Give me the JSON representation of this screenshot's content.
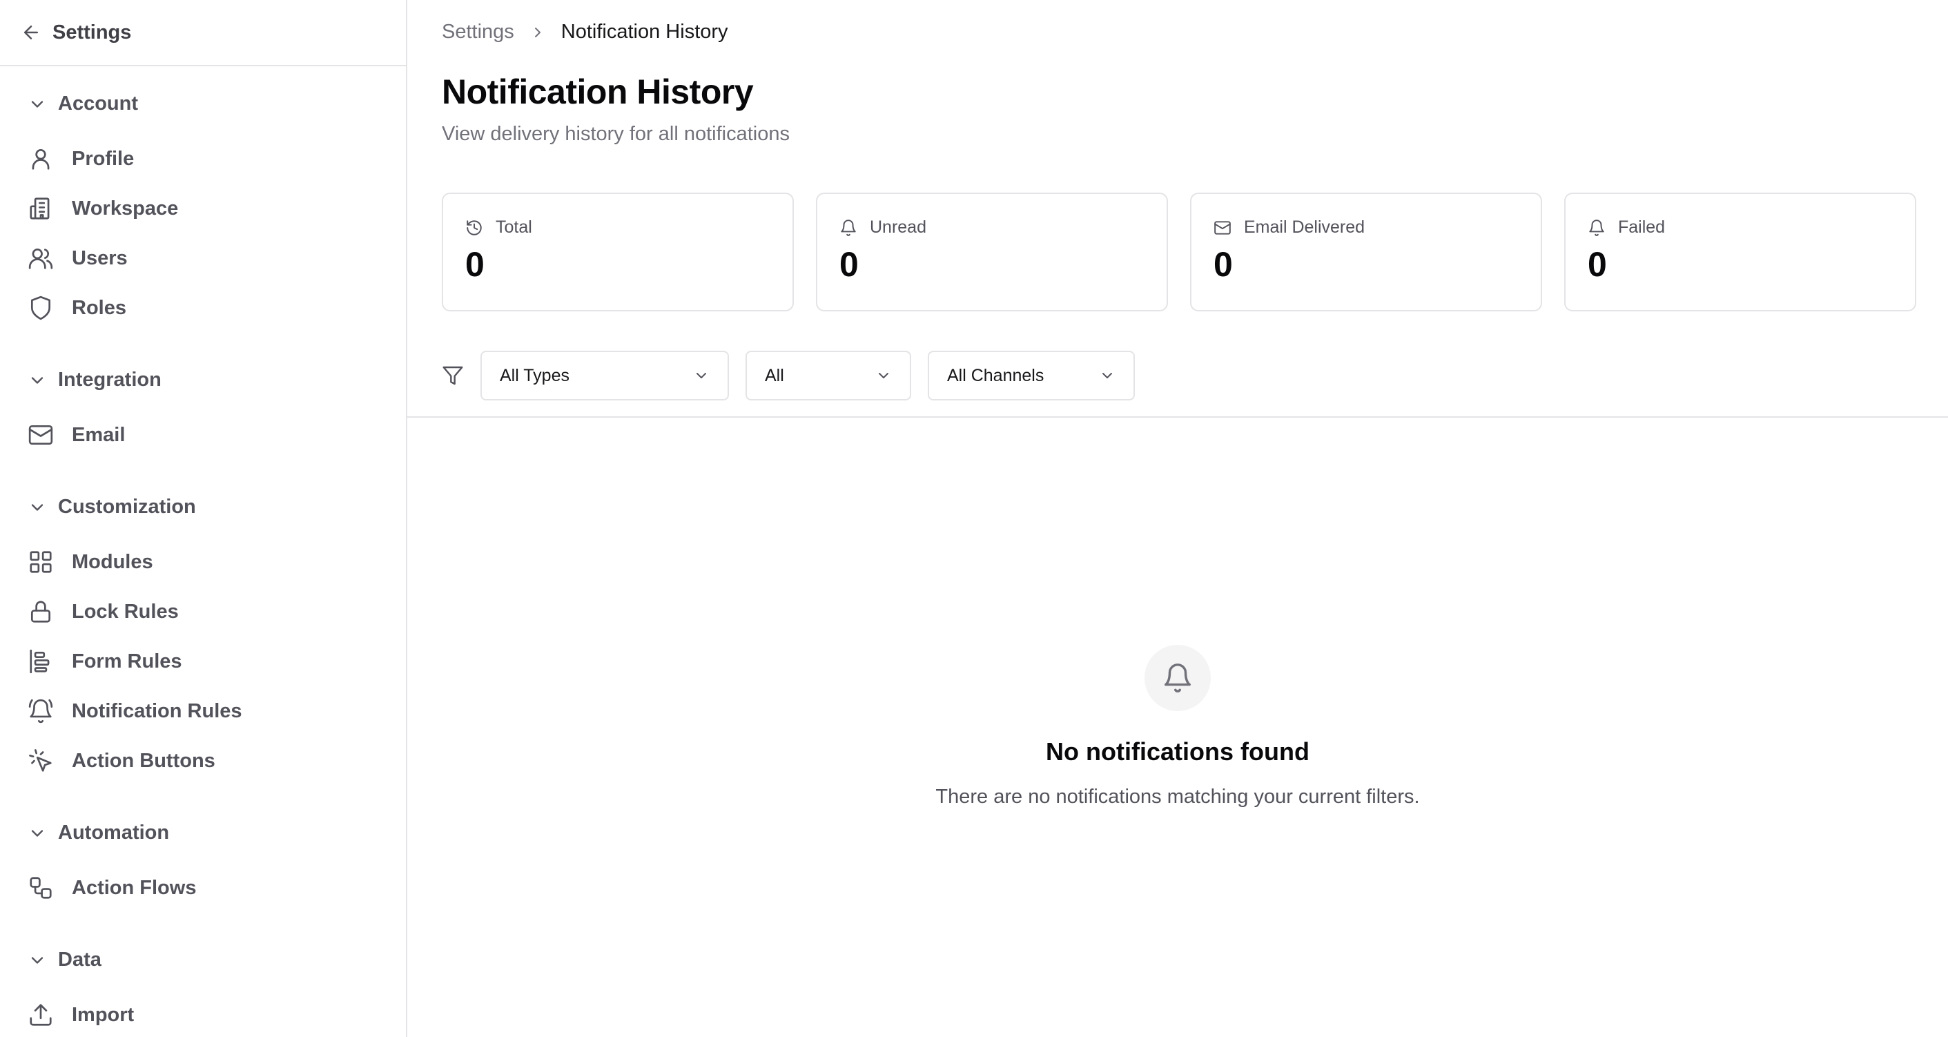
{
  "sidebar": {
    "back_label": "Settings",
    "sections": {
      "account": "Account",
      "integration": "Integration",
      "customization": "Customization",
      "automation": "Automation",
      "data": "Data"
    },
    "items": {
      "profile": "Profile",
      "workspace": "Workspace",
      "users": "Users",
      "roles": "Roles",
      "email": "Email",
      "modules": "Modules",
      "lock_rules": "Lock Rules",
      "form_rules": "Form Rules",
      "notification_rules": "Notification Rules",
      "action_buttons": "Action Buttons",
      "action_flows": "Action Flows",
      "import": "Import"
    }
  },
  "breadcrumb": {
    "parent": "Settings",
    "current": "Notification History"
  },
  "page": {
    "title": "Notification History",
    "subtitle": "View delivery history for all notifications"
  },
  "stats": [
    {
      "label": "Total",
      "value": "0",
      "icon": "history-icon"
    },
    {
      "label": "Unread",
      "value": "0",
      "icon": "bell-icon"
    },
    {
      "label": "Email Delivered",
      "value": "0",
      "icon": "mail-icon"
    },
    {
      "label": "Failed",
      "value": "0",
      "icon": "bell-icon"
    }
  ],
  "filters": {
    "type": "All Types",
    "status": "All",
    "channel": "All Channels"
  },
  "empty_state": {
    "title": "No notifications found",
    "text": "There are no notifications matching your current filters."
  }
}
